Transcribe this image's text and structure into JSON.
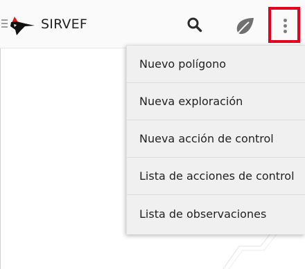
{
  "app_bar": {
    "title": "SIRVEF",
    "icons": {
      "menu": "hamburger-icon",
      "logo": "woodpecker-logo",
      "search": "search-icon",
      "leaf": "leaf-icon",
      "overflow": "more-vert-icon"
    },
    "highlight_color": "#e5001f"
  },
  "overflow_menu": {
    "items": [
      {
        "label": "Nuevo polígono"
      },
      {
        "label": "Nueva exploración"
      },
      {
        "label": "Nueva acción de control"
      },
      {
        "label": "Lista de acciones de control"
      },
      {
        "label": "Lista de observaciones"
      }
    ]
  }
}
